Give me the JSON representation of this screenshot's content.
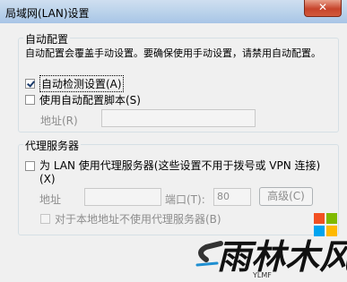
{
  "window": {
    "title": "局域网(LAN)设置",
    "close_label": "✕"
  },
  "auto_config": {
    "group_title": "自动配置",
    "description": "自动配置会覆盖手动设置。要确保使用手动设置，请禁用自动配置。",
    "auto_detect": {
      "label": "自动检测设置(A)",
      "checked": true
    },
    "use_script": {
      "label": "使用自动配置脚本(S)",
      "checked": false
    },
    "address_label": "地址(R)",
    "address_value": ""
  },
  "proxy": {
    "group_title": "代理服务器",
    "use_proxy": {
      "label_line1": "为 LAN 使用代理服务器(这些设置不用于拨号或 VPN 连接)",
      "label_line2": "(X)",
      "checked": false
    },
    "address_label": "地址",
    "address_value": "",
    "port_label": "端口(T):",
    "port_value": "80",
    "advanced_label": "高级(C)",
    "bypass_local": {
      "label": "对于本地地址不使用代理服务器(B)",
      "checked": false
    }
  },
  "watermark": {
    "text": "雨林木风",
    "subtext": "YLMF",
    "colors": [
      "#f25022",
      "#7fba00",
      "#00a4ef",
      "#ffb900"
    ]
  }
}
